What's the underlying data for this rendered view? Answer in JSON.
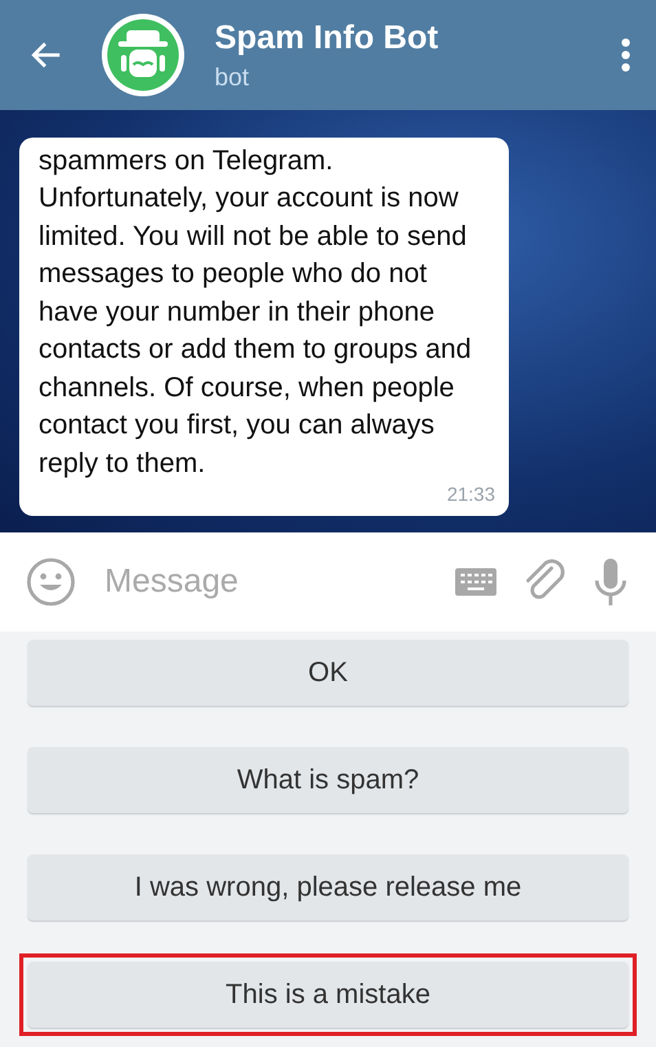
{
  "header": {
    "title": "Spam Info Bot",
    "subtitle": "bot"
  },
  "message": {
    "text": "spammers on Telegram. Unfortunately, your account is now limited. You will not be able to send messages to people who do not have your number in their phone contacts or add them to groups and channels. Of course, when people contact you first, you can always reply to them.",
    "time": "21:33"
  },
  "composer": {
    "placeholder": "Message"
  },
  "buttons": [
    {
      "label": "OK",
      "highlighted": false
    },
    {
      "label": "What is spam?",
      "highlighted": false
    },
    {
      "label": "I was wrong, please release me",
      "highlighted": false
    },
    {
      "label": "This is a mistake",
      "highlighted": true
    }
  ]
}
